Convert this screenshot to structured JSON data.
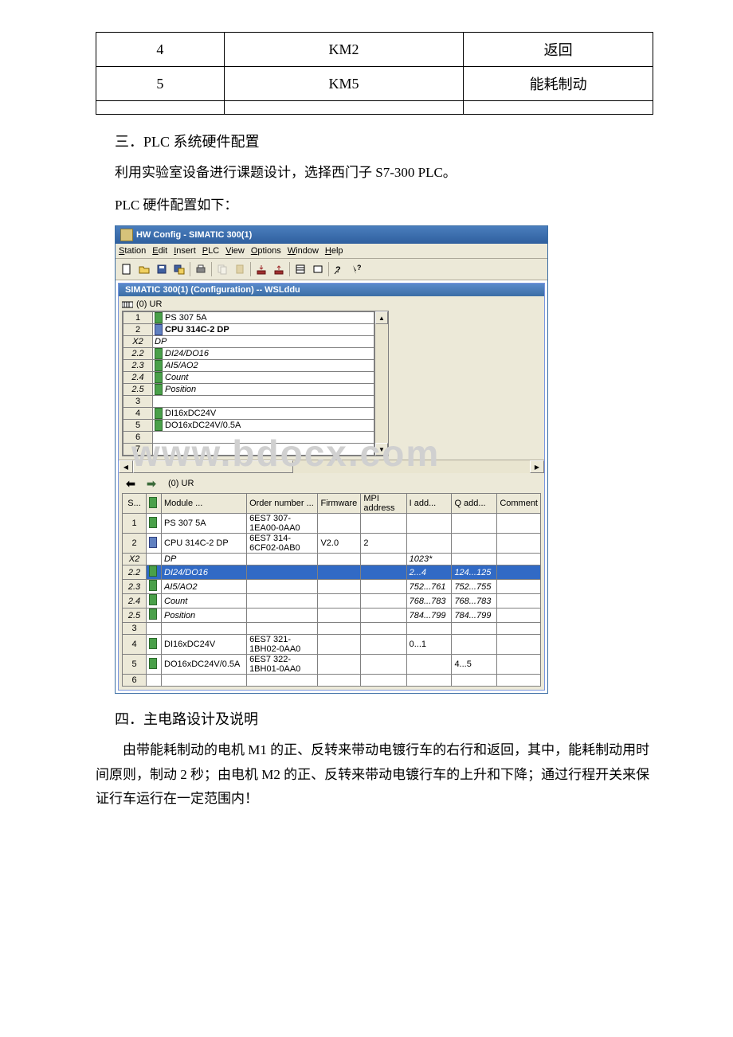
{
  "top_table": {
    "rows": [
      {
        "c1": "4",
        "c2": "KM2",
        "c3": "返回"
      },
      {
        "c1": "5",
        "c2": "KM5",
        "c3": "能耗制动"
      },
      {
        "c1": "",
        "c2": "",
        "c3": ""
      }
    ]
  },
  "section3_heading": "三．PLC 系统硬件配置",
  "section3_line1": "利用实验室设备进行课题设计，选择西门子 S7-300 PLC。",
  "section3_line2": "PLC 硬件配置如下：",
  "hwconfig": {
    "title": "HW Config - SIMATIC 300(1)",
    "menus": {
      "station": "Station",
      "edit": "Edit",
      "insert": "Insert",
      "plc": "PLC",
      "view": "View",
      "options": "Options",
      "window": "Window",
      "help": "Help"
    },
    "inner_title": "SIMATIC 300(1) (Configuration) -- WSLddu",
    "rack_label": "(0) UR",
    "rack_rows": [
      {
        "slot": "1",
        "name": "PS 307 5A",
        "style": "",
        "icon": "green"
      },
      {
        "slot": "2",
        "name": "CPU 314C-2 DP",
        "style": "bold",
        "icon": "blue"
      },
      {
        "slot": "X2",
        "name": "DP",
        "style": "italic",
        "icon": ""
      },
      {
        "slot": "2.2",
        "name": "DI24/DO16",
        "style": "italic",
        "icon": "green"
      },
      {
        "slot": "2.3",
        "name": "AI5/AO2",
        "style": "italic",
        "icon": "green"
      },
      {
        "slot": "2.4",
        "name": "Count",
        "style": "italic",
        "icon": "green"
      },
      {
        "slot": "2.5",
        "name": "Position",
        "style": "italic",
        "icon": "green"
      },
      {
        "slot": "3",
        "name": "",
        "style": "",
        "icon": ""
      },
      {
        "slot": "4",
        "name": "DI16xDC24V",
        "style": "",
        "icon": "green"
      },
      {
        "slot": "5",
        "name": "DO16xDC24V/0.5A",
        "style": "",
        "icon": "green"
      },
      {
        "slot": "6",
        "name": "",
        "style": "",
        "icon": ""
      },
      {
        "slot": "7",
        "name": "",
        "style": "",
        "icon": ""
      }
    ],
    "watermark": "www.bdocx.com",
    "detail_nav_label": "(0)     UR",
    "detail_columns": {
      "slot": "S...",
      "module": "Module   ...",
      "order": "Order number      ...",
      "firmware": "Firmware",
      "mpi": "MPI address",
      "iadd": "I add...",
      "qadd": "Q add...",
      "comment": "Comment"
    },
    "detail_rows": [
      {
        "slot": "1",
        "module": "PS 307 5A",
        "order": "6ES7 307-1EA00-0AA0",
        "firmware": "",
        "mpi": "",
        "iadd": "",
        "qadd": "",
        "comment": "",
        "icon": "green",
        "style": ""
      },
      {
        "slot": "2",
        "module": "CPU 314C-2 DP",
        "order": "6ES7 314-6CF02-0AB0",
        "firmware": "V2.0",
        "mpi": "2",
        "iadd": "",
        "qadd": "",
        "comment": "",
        "icon": "blue",
        "style": "bold"
      },
      {
        "slot": "X2",
        "module": "DP",
        "order": "",
        "firmware": "",
        "mpi": "",
        "iadd": "1023*",
        "qadd": "",
        "comment": "",
        "icon": "",
        "style": "italic"
      },
      {
        "slot": "2.2",
        "module": "DI24/DO16",
        "order": "",
        "firmware": "",
        "mpi": "",
        "iadd": "2...4",
        "qadd": "124...125",
        "comment": "",
        "icon": "green",
        "style": "italic",
        "sel": true
      },
      {
        "slot": "2.3",
        "module": "AI5/AO2",
        "order": "",
        "firmware": "",
        "mpi": "",
        "iadd": "752...761",
        "qadd": "752...755",
        "comment": "",
        "icon": "green",
        "style": "italic"
      },
      {
        "slot": "2.4",
        "module": "Count",
        "order": "",
        "firmware": "",
        "mpi": "",
        "iadd": "768...783",
        "qadd": "768...783",
        "comment": "",
        "icon": "green",
        "style": "italic"
      },
      {
        "slot": "2.5",
        "module": "Position",
        "order": "",
        "firmware": "",
        "mpi": "",
        "iadd": "784...799",
        "qadd": "784...799",
        "comment": "",
        "icon": "green",
        "style": "italic"
      },
      {
        "slot": "3",
        "module": "",
        "order": "",
        "firmware": "",
        "mpi": "",
        "iadd": "",
        "qadd": "",
        "comment": "",
        "icon": "",
        "style": ""
      },
      {
        "slot": "4",
        "module": "DI16xDC24V",
        "order": "6ES7 321-1BH02-0AA0",
        "firmware": "",
        "mpi": "",
        "iadd": "0...1",
        "qadd": "",
        "comment": "",
        "icon": "green",
        "style": ""
      },
      {
        "slot": "5",
        "module": "DO16xDC24V/0.5A",
        "order": "6ES7 322-1BH01-0AA0",
        "firmware": "",
        "mpi": "",
        "iadd": "",
        "qadd": "4...5",
        "comment": "",
        "icon": "green",
        "style": ""
      },
      {
        "slot": "6",
        "module": "",
        "order": "",
        "firmware": "",
        "mpi": "",
        "iadd": "",
        "qadd": "",
        "comment": "",
        "icon": "",
        "style": ""
      }
    ]
  },
  "section4_heading": "四．主电路设计及说明",
  "section4_para": "由带能耗制动的电机 M1 的正、反转来带动电镀行车的右行和返回，其中，能耗制动用时间原则，制动 2 秒；由电机 M2 的正、反转来带动电镀行车的上升和下降；通过行程开关来保证行车运行在一定范围内！"
}
